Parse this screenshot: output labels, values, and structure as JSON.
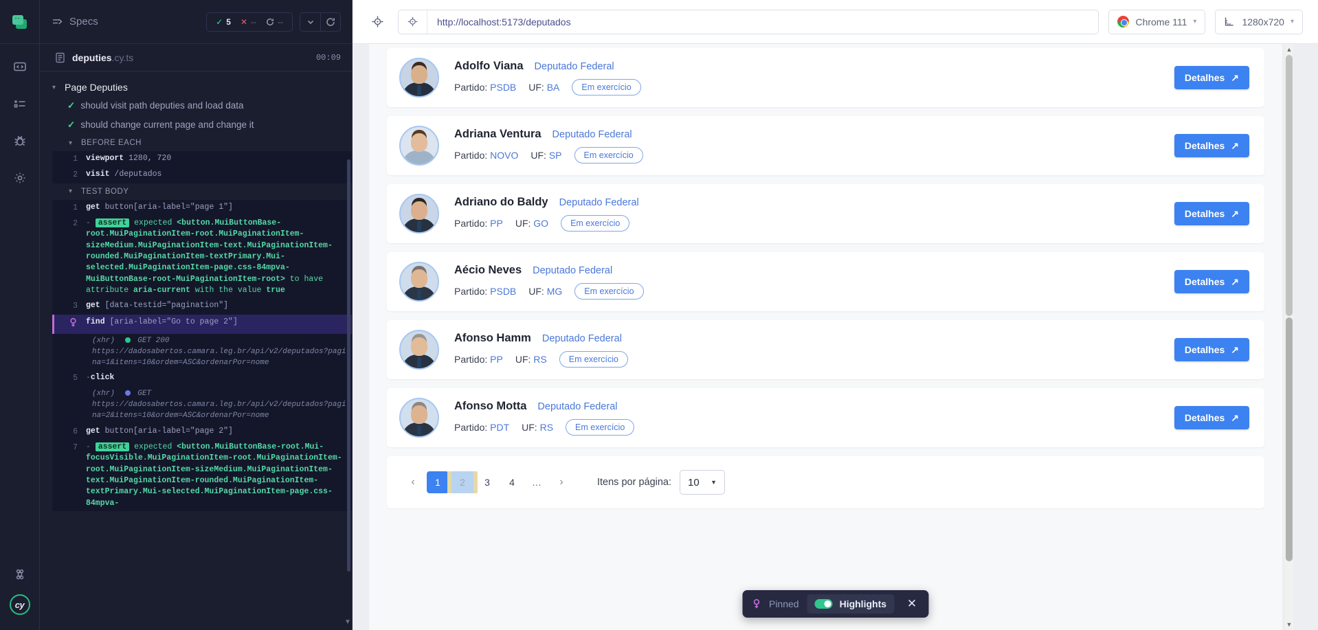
{
  "rail": {
    "logo_name": "cypress-logo",
    "items": [
      {
        "name": "sidebar-item-specs",
        "icon": "code-window-icon"
      },
      {
        "name": "sidebar-item-runs",
        "icon": "list-checks-icon"
      },
      {
        "name": "sidebar-item-debug",
        "icon": "bug-icon"
      },
      {
        "name": "sidebar-item-settings",
        "icon": "gear-icon"
      }
    ],
    "bottom": [
      {
        "name": "keyboard-shortcuts",
        "icon": "command-icon"
      },
      {
        "name": "cy-avatar",
        "label": "cy"
      }
    ]
  },
  "reporter": {
    "specs_label": "Specs",
    "stats": {
      "passed": "5",
      "failed": "--",
      "pending": "--"
    },
    "spec_name": "deputies",
    "spec_ext": ".cy.ts",
    "elapsed": "00:09",
    "suite": "Page Deputies",
    "tests": [
      {
        "label": "should visit path deputies and load data",
        "state": "passed"
      },
      {
        "label": "should change current page and change it",
        "state": "passed"
      }
    ],
    "hooks": [
      {
        "title": "BEFORE EACH",
        "commands": [
          {
            "num": "1",
            "name": "viewport",
            "message": "1280, 720"
          },
          {
            "num": "2",
            "name": "visit",
            "message": "/deputados"
          }
        ]
      },
      {
        "title": "TEST BODY",
        "commands": [
          {
            "num": "1",
            "name": "get",
            "message": "button[aria-label=\"page 1\"]"
          },
          {
            "num": "2",
            "type": "assert",
            "name": "assert",
            "prefix": "expected",
            "subject": "<button.MuiButtonBase-root.MuiPaginationItem-root.MuiPaginationItem-sizeMedium.MuiPaginationItem-text.MuiPaginationItem-rounded.MuiPaginationItem-textPrimary.Mui-selected.MuiPaginationItem-page.css-84mpva-MuiButtonBase-root-MuiPaginationItem-root>",
            "mid": "to have attribute",
            "attr": "aria-current",
            "tail": "with the value",
            "value": "true"
          },
          {
            "num": "3",
            "name": "get",
            "message": "[data-testid=\"pagination\"]"
          },
          {
            "num": "pin",
            "name": "find",
            "message": "[aria-label=\"Go to page 2\"]",
            "active": true
          },
          {
            "type": "xhr",
            "label": "(xhr)",
            "status": "GET 200",
            "dot": "green",
            "url": "https://dadosabertos.camara.leg.br/api/v2/deputados?pagina=1&itens=10&ordem=ASC&ordenarPor=nome"
          },
          {
            "num": "5",
            "name": "click",
            "message": ""
          },
          {
            "type": "xhr",
            "label": "(xhr)",
            "status": "GET",
            "dot": "blue",
            "url": "https://dadosabertos.camara.leg.br/api/v2/deputados?pagina=2&itens=10&ordem=ASC&ordenarPor=nome"
          },
          {
            "num": "6",
            "name": "get",
            "message": "button[aria-label=\"page 2\"]"
          },
          {
            "num": "7",
            "type": "assert",
            "name": "assert",
            "prefix": "expected",
            "subject": "<button.MuiButtonBase-root.Mui-focusVisible.MuiPaginationItem-root.MuiPaginationItem-root.MuiPaginationItem-sizeMedium.MuiPaginationItem-text.MuiPaginationItem-rounded.MuiPaginationItem-textPrimary.Mui-selected.MuiPaginationItem-page.css-84mpva-",
            "mid": "",
            "attr": "",
            "tail": "",
            "value": ""
          }
        ]
      }
    ]
  },
  "browser_bar": {
    "url": "http://localhost:5173/deputados",
    "browser": "Chrome 111",
    "viewport": "1280x720"
  },
  "app": {
    "deputies": [
      {
        "name": "Adolfo Viana",
        "role": "Deputado Federal",
        "party_label": "Partido:",
        "party": "PSDB",
        "uf_label": "UF:",
        "uf": "BA",
        "status": "Em exercício",
        "details": "Detalhes",
        "skin": "#d9b08c",
        "hair": "#3b2b22",
        "suit": "#24303f"
      },
      {
        "name": "Adriana Ventura",
        "role": "Deputado Federal",
        "party_label": "Partido:",
        "party": "NOVO",
        "uf_label": "UF:",
        "uf": "SP",
        "status": "Em exercício",
        "details": "Detalhes",
        "skin": "#e3bc9b",
        "hair": "#5a3a2a",
        "suit": "#9fb3c8"
      },
      {
        "name": "Adriano do Baldy",
        "role": "Deputado Federal",
        "party_label": "Partido:",
        "party": "PP",
        "uf_label": "UF:",
        "uf": "GO",
        "status": "Em exercício",
        "details": "Detalhes",
        "skin": "#dcb08e",
        "hair": "#2e2622",
        "suit": "#28323f"
      },
      {
        "name": "Aécio Neves",
        "role": "Deputado Federal",
        "party_label": "Partido:",
        "party": "PSDB",
        "uf_label": "UF:",
        "uf": "MG",
        "status": "Em exercício",
        "details": "Detalhes",
        "skin": "#e0b794",
        "hair": "#7a736c",
        "suit": "#2b3646"
      },
      {
        "name": "Afonso Hamm",
        "role": "Deputado Federal",
        "party_label": "Partido:",
        "party": "PP",
        "uf_label": "UF:",
        "uf": "RS",
        "status": "Em exercício",
        "details": "Detalhes",
        "skin": "#e2bb98",
        "hair": "#9a968f",
        "suit": "#273140"
      },
      {
        "name": "Afonso Motta",
        "role": "Deputado Federal",
        "party_label": "Partido:",
        "party": "PDT",
        "uf_label": "UF:",
        "uf": "RS",
        "status": "Em exercício",
        "details": "Detalhes",
        "skin": "#ddb390",
        "hair": "#8d8781",
        "suit": "#2a3443"
      }
    ],
    "pagination": {
      "prev": "‹",
      "next": "›",
      "pages": [
        "1",
        "2",
        "3",
        "4",
        "…"
      ],
      "selected": "1",
      "highlighted": "2",
      "per_page_label": "Itens por página:",
      "per_page_value": "10"
    }
  },
  "toast": {
    "pinned_label": "Pinned",
    "highlights_label": "Highlights",
    "highlights_on": true
  },
  "colors": {
    "accent_blue": "#3c82f0",
    "pass_green": "#3fd39a",
    "pin_purple": "#c06ad8",
    "panel_bg": "#1b1e2e"
  }
}
